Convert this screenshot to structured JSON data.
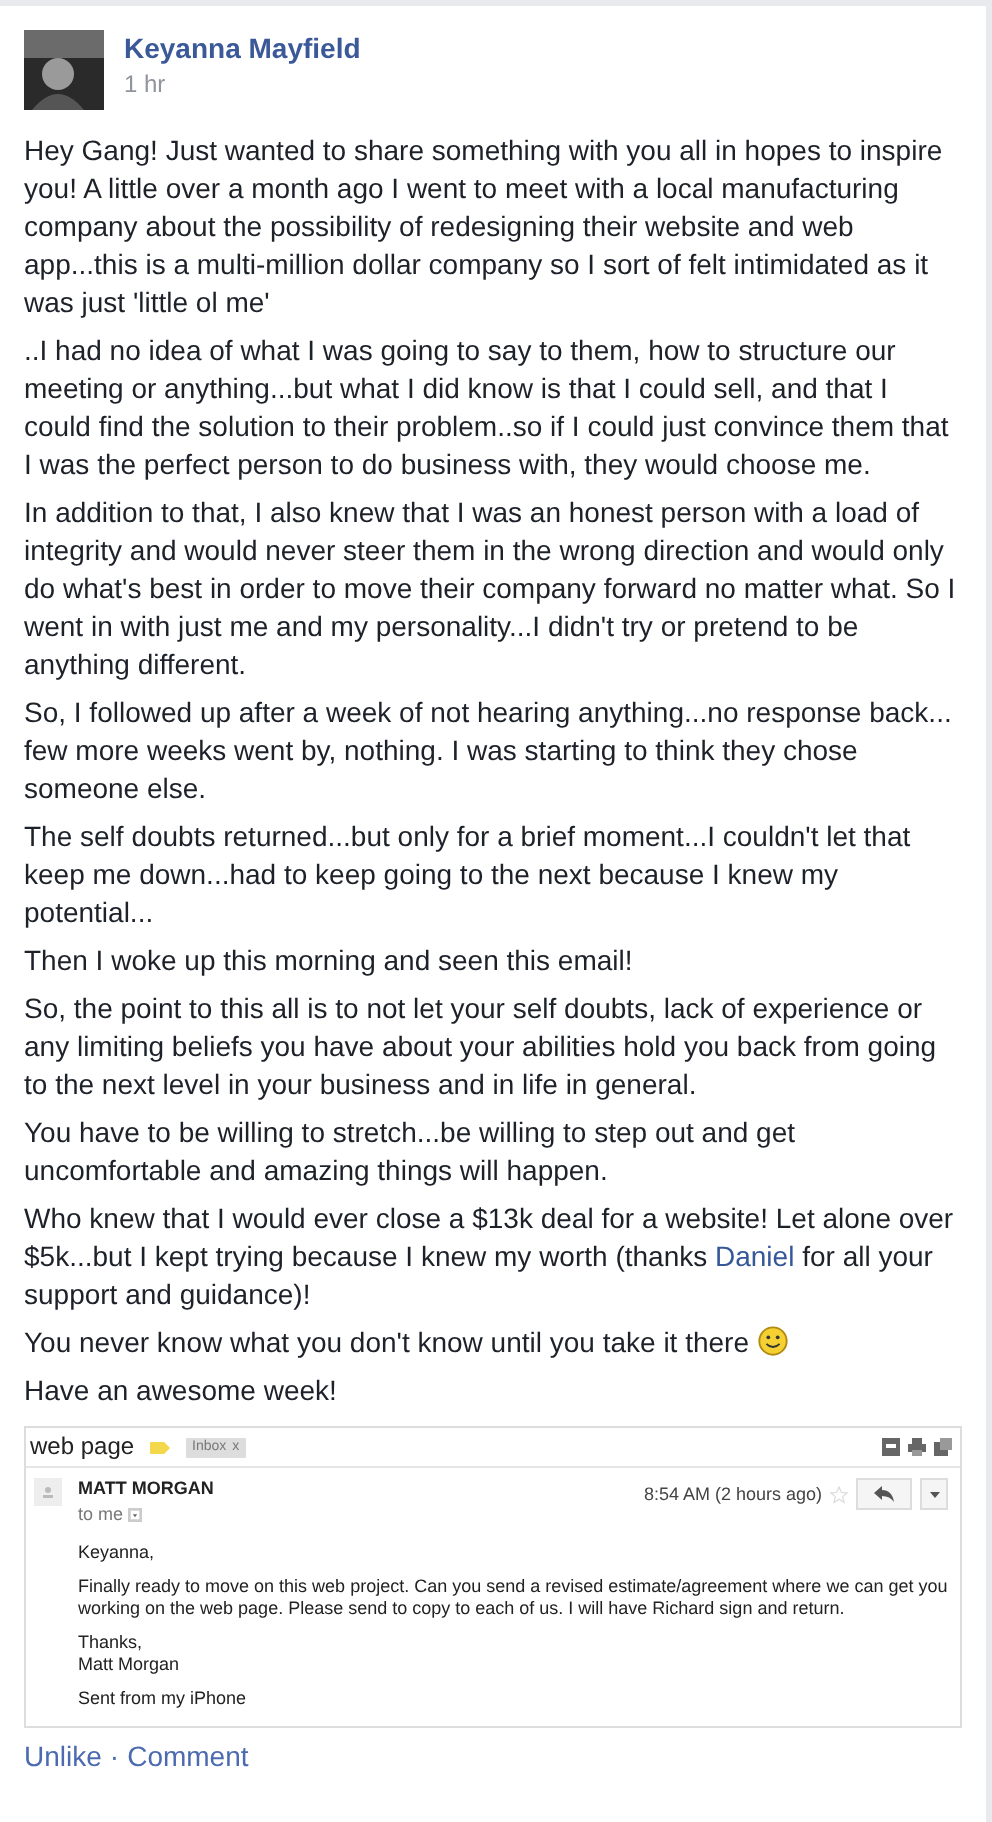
{
  "author": {
    "name": "Keyanna Mayfield",
    "time": "1 hr"
  },
  "paragraphs": [
    {
      "text": "Hey Gang! Just wanted to share something with you all in hopes to inspire you! A little over a month ago I went to meet with a local manufacturing company about the possibility of redesigning their website and web app...this is a multi-million dollar company so I sort of felt intimidated as it was just 'little ol me'"
    },
    {
      "text": "..I had no idea of what I was going to say to them, how to structure our meeting or anything...but what I did know is that I could sell, and that I could find the solution to their problem..so if I could just convince them that I was the perfect person to do business with, they would choose me."
    },
    {
      "text": "In addition to that, I also knew that I was an honest person with a load of integrity and would never steer them in the wrong direction and would only do what's best in order to move their company forward no matter what. So I went in with just me and my personality...I didn't try or pretend to be anything different."
    },
    {
      "text": "So, I followed up after a week of not hearing anything...no response back... few more weeks went by, nothing. I was starting to think they chose someone else."
    },
    {
      "text": "The self doubts returned...but only for a brief moment...I couldn't let that keep me down...had to keep going to the next because I knew my potential..."
    },
    {
      "text": "Then I woke up this morning and seen this email!"
    },
    {
      "text": "So, the point to this all is to not let your self doubts, lack of experience or any limiting beliefs you have about your abilities hold you back from going to the next level in your business and in life in general."
    },
    {
      "text": "You have to be willing to stretch...be willing to step out and get uncomfortable and amazing things will happen."
    },
    {
      "text": "Who knew that I would ever close a $13k deal for a website! Let alone over $5k...but I kept trying because I knew my worth (thanks ",
      "link": "Daniel",
      "after": " for all your support and guidance)!"
    },
    {
      "text": "You never know what you don't know until you take it there",
      "emoticon": true
    },
    {
      "text": "Have an awesome week!"
    }
  ],
  "email": {
    "subject": "web page",
    "label": "Inbox",
    "label_close": "x",
    "sender": "MATT MORGAN",
    "recipient": "to me",
    "time": "8:54 AM (2 hours ago)",
    "starred": false,
    "body": [
      {
        "lines": [
          "Keyanna,"
        ]
      },
      {
        "lines": [
          "Finally ready to move on this web project.  Can you send a revised estimate/agreement where we can get you working on the web page.  Please send to copy to each of us.  I will have Richard sign and return."
        ]
      },
      {
        "lines": [
          "Thanks,",
          "Matt Morgan"
        ]
      },
      {
        "lines": [
          "Sent from my iPhone"
        ]
      }
    ]
  },
  "actions": {
    "like": "Unlike",
    "separator": "·",
    "comment": "Comment"
  }
}
